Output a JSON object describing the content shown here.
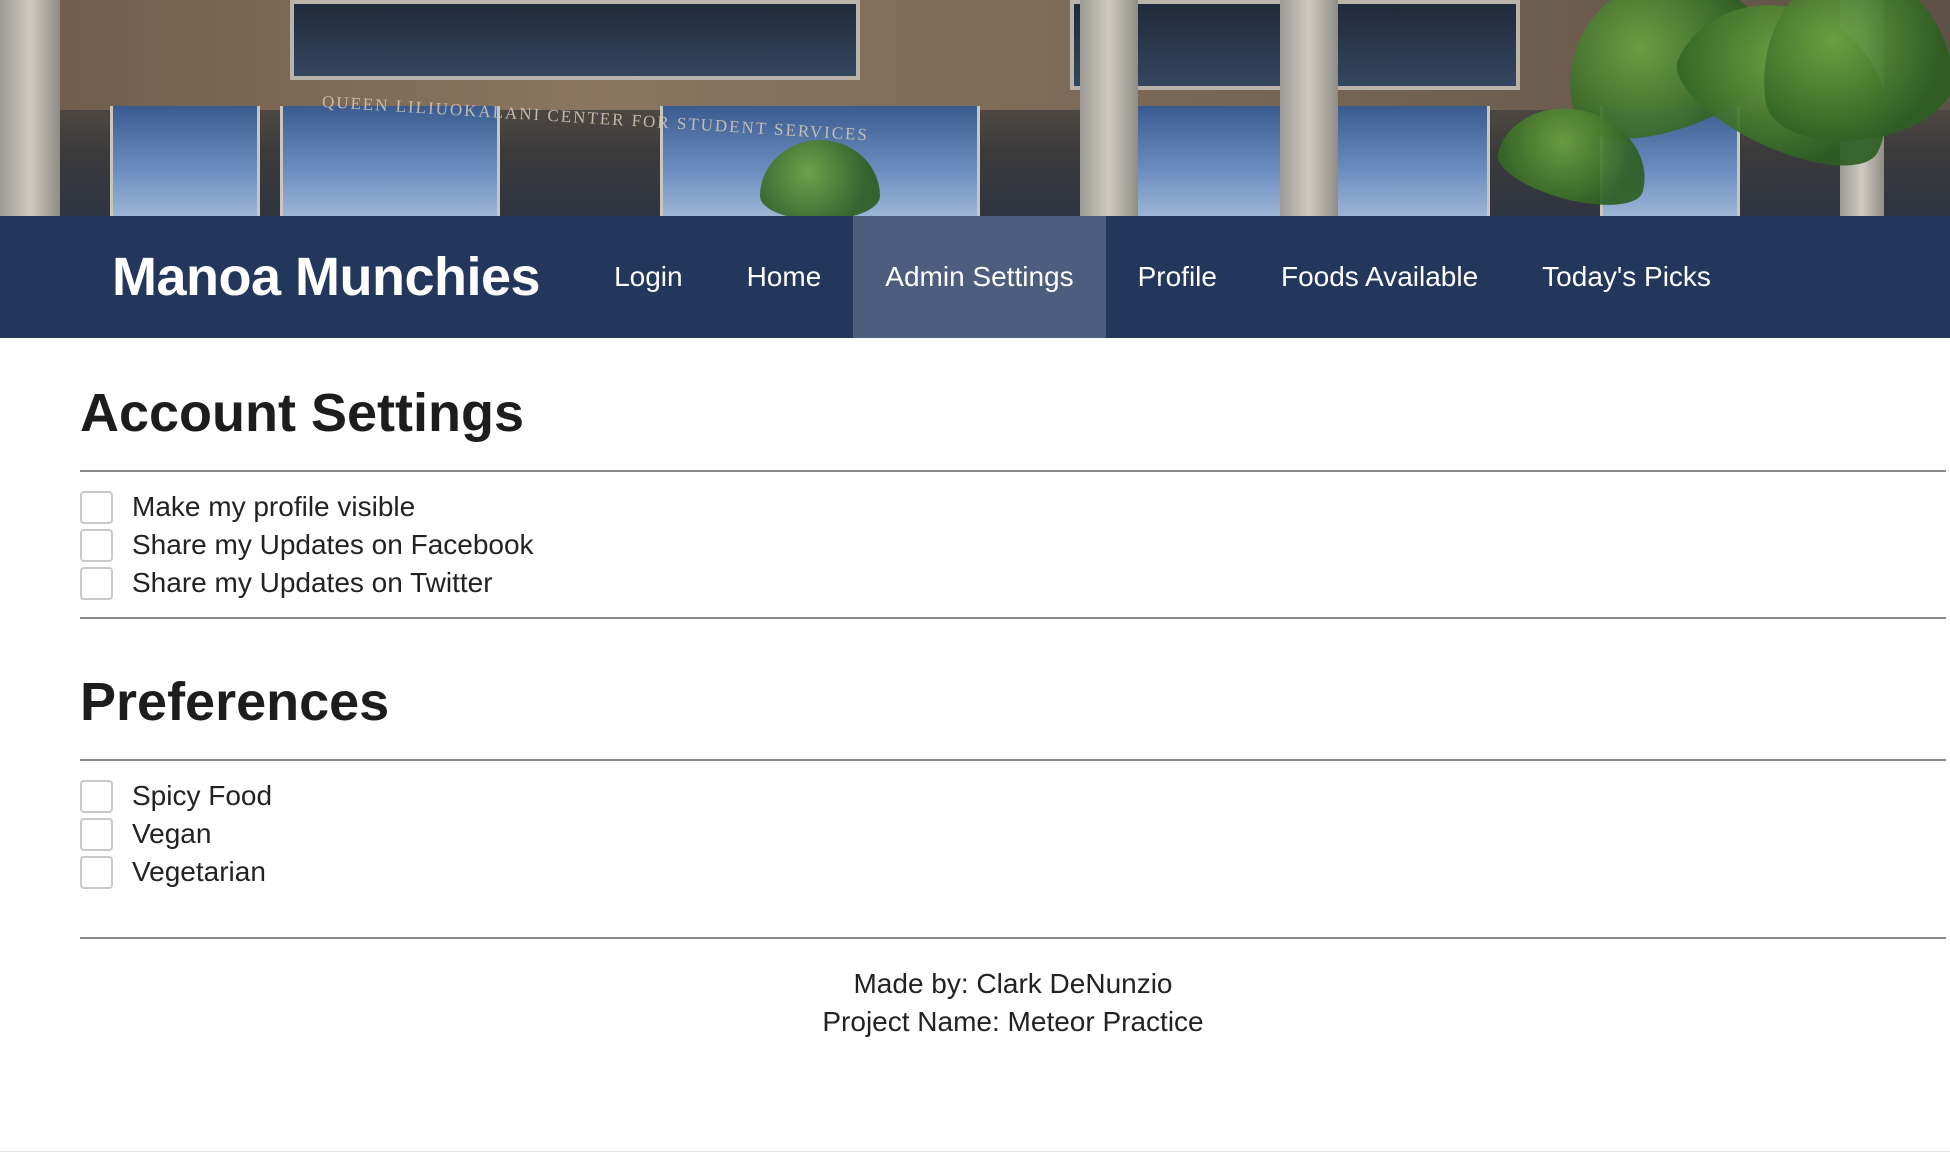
{
  "banner": {
    "sign_text": "QUEEN LILIUOKALANI CENTER FOR STUDENT SERVICES"
  },
  "navbar": {
    "brand": "Manoa Munchies",
    "items": [
      {
        "label": "Login",
        "active": false
      },
      {
        "label": "Home",
        "active": false
      },
      {
        "label": "Admin Settings",
        "active": true
      },
      {
        "label": "Profile",
        "active": false
      },
      {
        "label": "Foods Available",
        "active": false
      },
      {
        "label": "Today's Picks",
        "active": false
      }
    ]
  },
  "account_settings": {
    "title": "Account Settings",
    "options": [
      {
        "label": "Make my profile visible",
        "checked": false
      },
      {
        "label": "Share my Updates on Facebook",
        "checked": false
      },
      {
        "label": "Share my Updates on Twitter",
        "checked": false
      }
    ]
  },
  "preferences": {
    "title": "Preferences",
    "options": [
      {
        "label": "Spicy Food",
        "checked": false
      },
      {
        "label": "Vegan",
        "checked": false
      },
      {
        "label": "Vegetarian",
        "checked": false
      }
    ]
  },
  "footer": {
    "made_by": "Made by: Clark DeNunzio",
    "project_name": "Project Name: Meteor Practice"
  },
  "colors": {
    "navbar_bg": "#23365b",
    "navbar_active_bg": "#4d5d7e",
    "text": "#222222"
  }
}
